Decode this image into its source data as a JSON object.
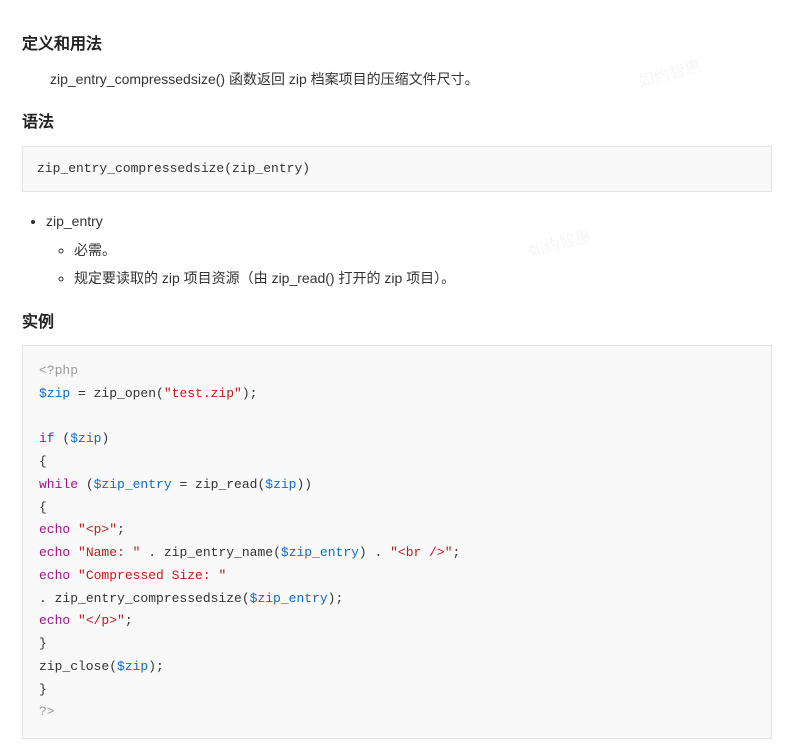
{
  "sections": {
    "definition": {
      "title": "定义和用法",
      "desc": "zip_entry_compressedsize() 函数返回 zip 档案项目的压缩文件尺寸。"
    },
    "syntax": {
      "title": "语法",
      "code": "zip_entry_compressedsize(zip_entry)",
      "params": {
        "name": "zip_entry",
        "required": "必需。",
        "desc": "规定要读取的 zip 项目资源（由 zip_read() 打开的 zip 项目）。"
      }
    },
    "example": {
      "title": "实例",
      "code_tokens": [
        {
          "t": "php-tag",
          "v": "<?php"
        },
        {
          "t": "nl"
        },
        {
          "t": "var",
          "v": "$zip"
        },
        {
          "t": "op",
          "v": " = "
        },
        {
          "t": "func",
          "v": "zip_open("
        },
        {
          "t": "str",
          "v": "\"test.zip\""
        },
        {
          "t": "func",
          "v": ");"
        },
        {
          "t": "nl"
        },
        {
          "t": "nl"
        },
        {
          "t": "kw",
          "v": "if"
        },
        {
          "t": "op",
          "v": " ("
        },
        {
          "t": "var",
          "v": "$zip"
        },
        {
          "t": "op",
          "v": ")"
        },
        {
          "t": "nl"
        },
        {
          "t": "op",
          "v": "{"
        },
        {
          "t": "nl"
        },
        {
          "t": "kw",
          "v": "while"
        },
        {
          "t": "op",
          "v": " ("
        },
        {
          "t": "var",
          "v": "$zip_entry"
        },
        {
          "t": "op",
          "v": " = "
        },
        {
          "t": "func",
          "v": "zip_read("
        },
        {
          "t": "var",
          "v": "$zip"
        },
        {
          "t": "func",
          "v": "))"
        },
        {
          "t": "nl"
        },
        {
          "t": "op",
          "v": "{"
        },
        {
          "t": "nl"
        },
        {
          "t": "kw",
          "v": "echo"
        },
        {
          "t": "op",
          "v": " "
        },
        {
          "t": "str",
          "v": "\"<p>\""
        },
        {
          "t": "op",
          "v": ";"
        },
        {
          "t": "nl"
        },
        {
          "t": "kw",
          "v": "echo"
        },
        {
          "t": "op",
          "v": " "
        },
        {
          "t": "str",
          "v": "\"Name: \""
        },
        {
          "t": "op",
          "v": " . "
        },
        {
          "t": "func",
          "v": "zip_entry_name("
        },
        {
          "t": "var",
          "v": "$zip_entry"
        },
        {
          "t": "func",
          "v": ")"
        },
        {
          "t": "op",
          "v": " . "
        },
        {
          "t": "str",
          "v": "\"<br />\""
        },
        {
          "t": "op",
          "v": ";"
        },
        {
          "t": "nl"
        },
        {
          "t": "kw",
          "v": "echo"
        },
        {
          "t": "op",
          "v": " "
        },
        {
          "t": "str",
          "v": "\"Compressed Size: \""
        },
        {
          "t": "nl"
        },
        {
          "t": "op",
          "v": ". "
        },
        {
          "t": "func",
          "v": "zip_entry_compressedsize("
        },
        {
          "t": "var",
          "v": "$zip_entry"
        },
        {
          "t": "func",
          "v": ");"
        },
        {
          "t": "nl"
        },
        {
          "t": "kw",
          "v": "echo"
        },
        {
          "t": "op",
          "v": " "
        },
        {
          "t": "str",
          "v": "\"</p>\""
        },
        {
          "t": "op",
          "v": ";"
        },
        {
          "t": "nl"
        },
        {
          "t": "op",
          "v": "}"
        },
        {
          "t": "nl"
        },
        {
          "t": "func",
          "v": "zip_close("
        },
        {
          "t": "var",
          "v": "$zip"
        },
        {
          "t": "func",
          "v": ");"
        },
        {
          "t": "nl"
        },
        {
          "t": "op",
          "v": "}"
        },
        {
          "t": "nl"
        },
        {
          "t": "php-tag",
          "v": "?>"
        }
      ]
    }
  },
  "watermark": "如约智惠"
}
